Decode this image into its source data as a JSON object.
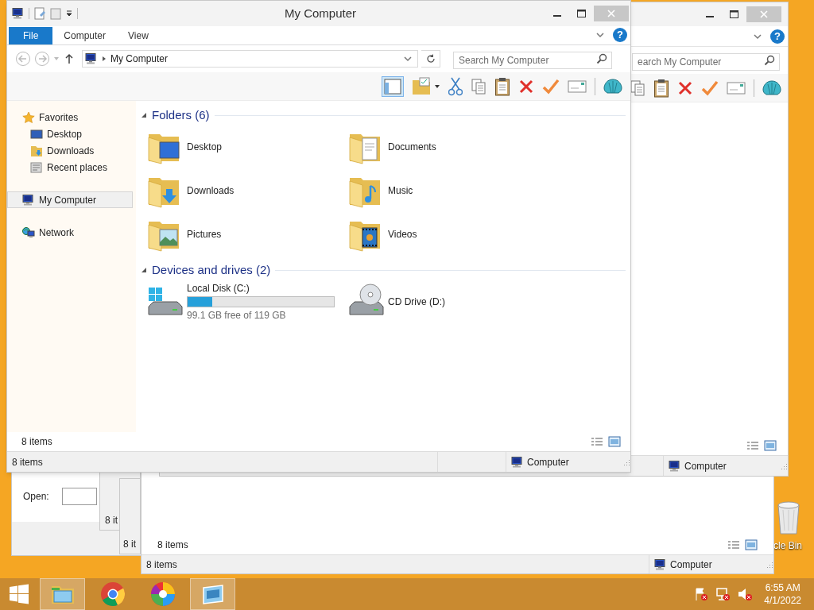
{
  "main_window": {
    "title": "My Computer",
    "ribbon_tabs": [
      {
        "label": "File",
        "selected": true
      },
      {
        "label": "Computer",
        "selected": false
      },
      {
        "label": "View",
        "selected": false
      }
    ],
    "help_glyph": "?",
    "address": {
      "path": "My Computer"
    },
    "search": {
      "placeholder": "Search My Computer"
    },
    "nav": [
      {
        "label": "Favorites",
        "kind": "favorites",
        "selected": false,
        "children": [
          {
            "label": "Desktop",
            "kind": "desktop",
            "selected": false
          },
          {
            "label": "Downloads",
            "kind": "downloads",
            "selected": false
          },
          {
            "label": "Recent places",
            "kind": "recent",
            "selected": false
          }
        ]
      },
      {
        "label": "My Computer",
        "kind": "computer",
        "selected": true
      },
      {
        "label": "Network",
        "kind": "network",
        "selected": false
      }
    ],
    "groups": [
      {
        "title": "Folders (6)",
        "items": [
          {
            "label": "Desktop",
            "kind": "desktop"
          },
          {
            "label": "Documents",
            "kind": "documents"
          },
          {
            "label": "Downloads",
            "kind": "downloads"
          },
          {
            "label": "Music",
            "kind": "music"
          },
          {
            "label": "Pictures",
            "kind": "pictures"
          },
          {
            "label": "Videos",
            "kind": "videos"
          }
        ]
      },
      {
        "title": "Devices and drives (2)",
        "items": [
          {
            "label": "Local Disk (C:)",
            "kind": "disk",
            "level": 0.17,
            "reading": "99.1 GB free of 119 GB"
          },
          {
            "label": "CD Drive (D:)",
            "kind": "cd"
          }
        ]
      }
    ],
    "inner_status": "8 items",
    "status_bar": {
      "items": "8 items",
      "location": "Computer"
    }
  },
  "back_window": {
    "help_glyph": "?",
    "search_placeholder": "earch My Computer",
    "location": "Computer"
  },
  "lower_window": {
    "inner_status": "8 items",
    "items": "8 items",
    "location": "Computer"
  },
  "run_dialog": {
    "label": "Open:"
  },
  "stacked_windows": [
    "8 it",
    "8 it"
  ],
  "recycle_bin": {
    "label": "cle Bin"
  },
  "taskbar": {
    "apps": [
      {
        "kind": "explorer",
        "selected": true
      },
      {
        "kind": "chrome",
        "selected": false
      },
      {
        "kind": "photos",
        "selected": false
      },
      {
        "kind": "window",
        "selected": true
      }
    ],
    "time": "6:55 AM",
    "date": "4/1/2022"
  }
}
